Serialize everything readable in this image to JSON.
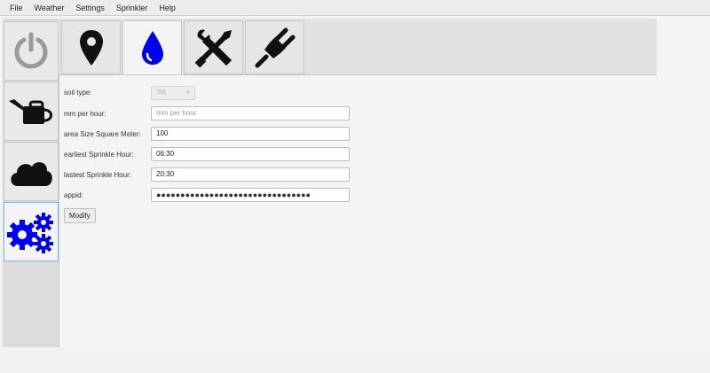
{
  "menu": [
    "File",
    "Weather",
    "Settings",
    "Sprinkler",
    "Help"
  ],
  "side_tabs": [
    {
      "icon": "power-icon",
      "selected": false
    },
    {
      "icon": "watering-can-icon",
      "selected": false
    },
    {
      "icon": "cloud-icon",
      "selected": false
    },
    {
      "icon": "gears-icon",
      "selected": true
    }
  ],
  "top_tabs": [
    {
      "icon": "location-pin-icon",
      "selected": false
    },
    {
      "icon": "water-drop-icon",
      "selected": true
    },
    {
      "icon": "tools-icon",
      "selected": false
    },
    {
      "icon": "plug-icon",
      "selected": false
    }
  ],
  "form": {
    "soil_type_label": "soil type:",
    "soil_type_value": "Silt",
    "mm_per_hour_label": "mm per hour:",
    "mm_per_hour_placeholder": "mm per hour",
    "area_label": "area Size Square Meter:",
    "area_value": "100",
    "earliest_label": "earliest Sprinkle Hour:",
    "earliest_value": "06:30",
    "latest_label": "lastest Sprinkle Hour:",
    "latest_value": "20:30",
    "appid_label": "appid:",
    "appid_mask": "●●●●●●●●●●●●●●●●●●●●●●●●●●●●●●●●",
    "modify_label": "Modify"
  },
  "colors": {
    "accent": "#0000ee",
    "power_gray": "#9a9a9a",
    "icon_black": "#111111"
  }
}
